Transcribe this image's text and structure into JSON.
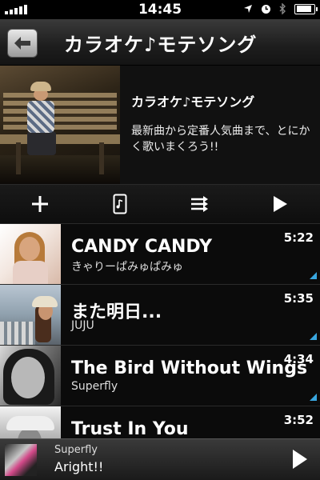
{
  "status_bar": {
    "time": "14:45",
    "icons": [
      "signal-icon",
      "location-icon",
      "alarm-icon",
      "bluetooth-icon",
      "battery-icon"
    ]
  },
  "nav": {
    "title": "カラオケ♪モテソング",
    "back_icon": "back-arrow-icon"
  },
  "playlist": {
    "title": "カラオケ♪モテソング",
    "description": "最新曲から定番人気曲まで、とにかく歌いまくろう!!"
  },
  "toolbar": {
    "items": [
      "add-icon",
      "phone-download-icon",
      "shuffle-icon",
      "play-icon"
    ]
  },
  "tracks": [
    {
      "title": "CANDY CANDY",
      "artist": "きゃりーぱみゅぱみゅ",
      "duration": "5:22"
    },
    {
      "title": "また明日...",
      "artist": "JUJU",
      "duration": "5:35"
    },
    {
      "title": "The Bird Without Wings",
      "artist": "Superfly",
      "duration": "4:34"
    },
    {
      "title": "Trust In You",
      "artist": "",
      "duration": "3:52"
    }
  ],
  "now_playing": {
    "artist": "Superfly",
    "title": "Aright!!"
  },
  "colors": {
    "accent": "#39a7e0",
    "background": "#000000"
  }
}
